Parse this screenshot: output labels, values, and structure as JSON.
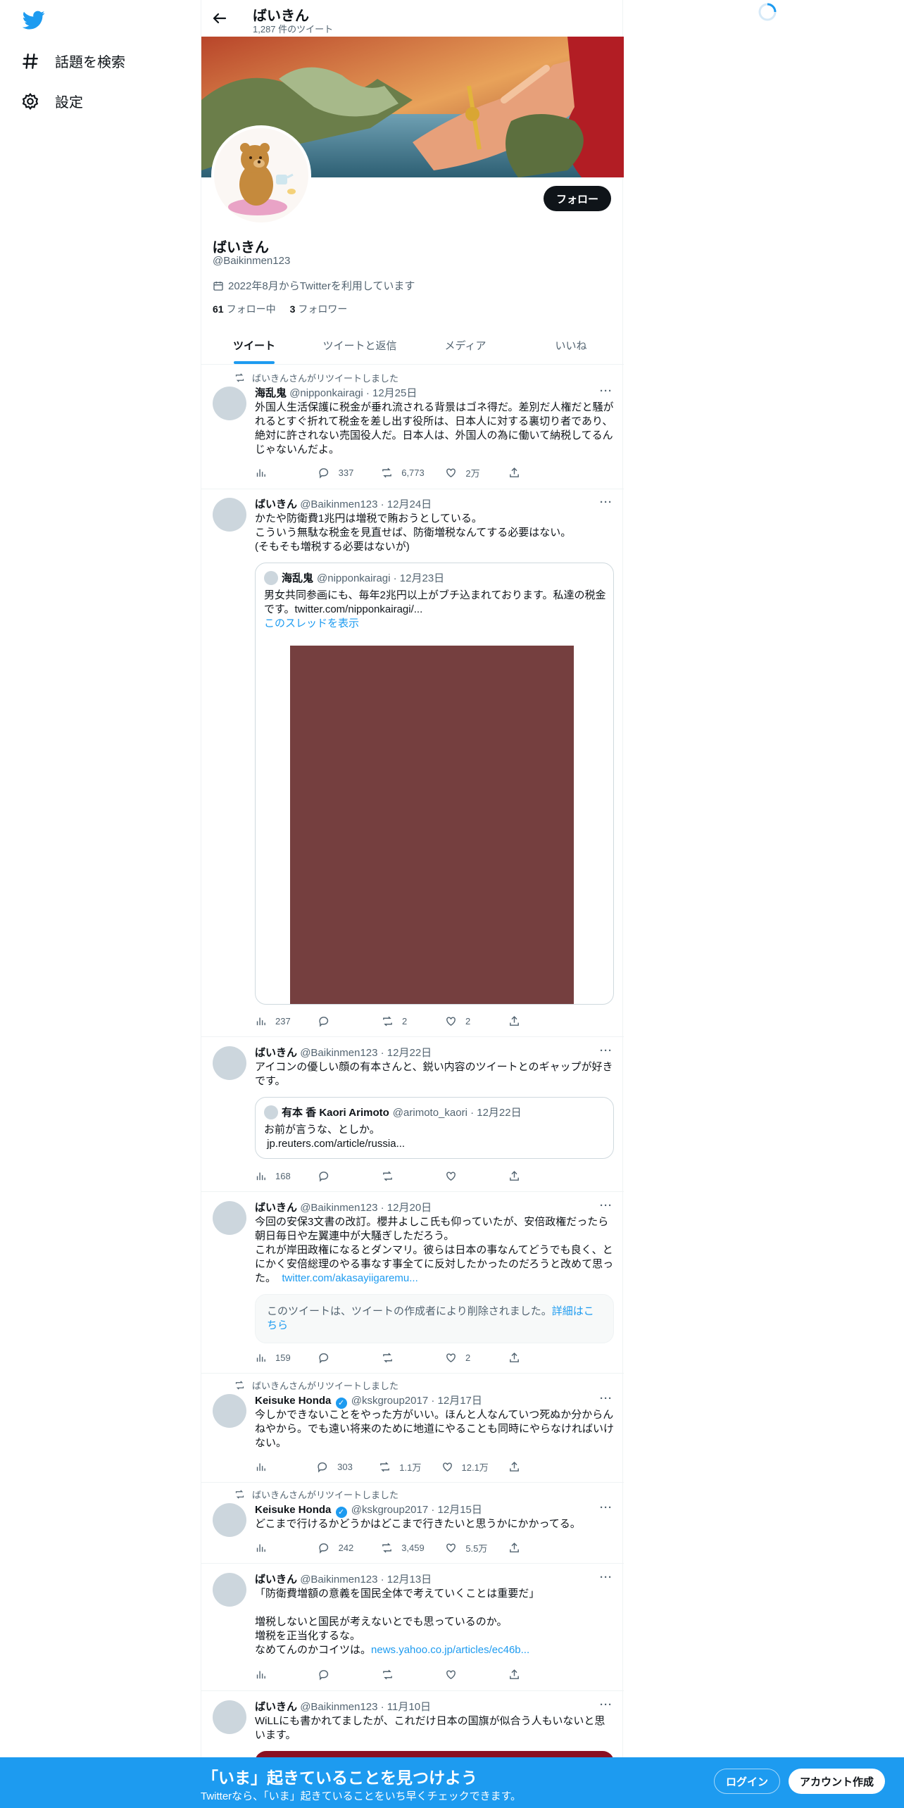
{
  "nav": {
    "explore_label": "話題を検索",
    "settings_label": "設定"
  },
  "header": {
    "title": "ばいきん",
    "subtitle": "1,287 件のツイート"
  },
  "profile": {
    "follow_label": "フォロー",
    "name": "ばいきん",
    "handle": "@Baikinmen123",
    "joined": "2022年8月からTwitterを利用しています",
    "following_count": "61",
    "following_label": "フォロー中",
    "followers_count": "3",
    "followers_label": "フォロワー"
  },
  "tabs": [
    "ツイート",
    "ツイートと返信",
    "メディア",
    "いいね"
  ],
  "tweets": [
    {
      "retweeted_by": "ばいきんさんがリツイートしました",
      "name": "海乱鬼",
      "meta": "@nipponkairagi · 12月25日",
      "text": "外国人生活保護に税金が垂れ流される背景はゴネ得だ。差別だ人権だと騒がれるとすぐ折れて税金を差し出す役所は、日本人に対する裏切り者であり、絶対に許されない売国役人だ。日本人は、外国人の為に働いて納税してるんじゃないんだよ。",
      "views": "",
      "replies": "337",
      "retweets": "6,773",
      "likes": "2万"
    },
    {
      "name": "ばいきん",
      "meta": "@Baikinmen123 · 12月24日",
      "text": "かたや防衛費1兆円は増税で賄おうとしている。\nこういう無駄な税金を見直せば、防衛増税なんてする必要はない。\n(そもそも増税する必要はないが)",
      "quote_name": "海乱鬼",
      "quote_meta": "@nipponkairagi · 12月23日",
      "quote_text": "男女共同参画にも、毎年2兆円以上がブチ込まれております。私達の税金です。twitter.com/nipponkairagi/...",
      "quote_link": "このスレッドを表示",
      "views": "237",
      "replies": "",
      "retweets": "2",
      "likes": "2"
    },
    {
      "name": "ばいきん",
      "meta": "@Baikinmen123 · 12月22日",
      "text": "アイコンの優しい顔の有本さんと、鋭い内容のツイートとのギャップが好きです。",
      "quote_name": "有本 香 Kaori Arimoto",
      "quote_meta": "@arimoto_kaori · 12月22日",
      "quote_text": "お前が言うな、としか。\n jp.reuters.com/article/russia...",
      "views": "168",
      "replies": "",
      "retweets": "",
      "likes": ""
    },
    {
      "name": "ばいきん",
      "meta": "@Baikinmen123 · 12月20日",
      "text": "今回の安保3文書の改訂。櫻井よしこ氏も仰っていたが、安倍政権だったら朝日毎日や左翼連中が大騒ぎしただろう。\nこれが岸田政権になるとダンマリ。彼らは日本の事なんてどうでも良く、とにかく安倍総理のやる事なす事全てに反対したかったのだろうと改めて思った。",
      "text_link": "twitter.com/akasayiigaremu...",
      "deleted_text": "このツイートは、ツイートの作成者により削除されました。",
      "deleted_link": "詳細はこちら",
      "views": "159",
      "replies": "",
      "retweets": "",
      "likes": "2"
    },
    {
      "retweeted_by": "ばいきんさんがリツイートしました",
      "name": "Keisuke Honda",
      "meta": "@kskgroup2017 · 12月17日",
      "text": "今しかできないことをやった方がいい。ほんと人なんていつ死ぬか分からんねやから。でも遠い将来のために地道にやることも同時にやらなければいけない。",
      "views": "",
      "replies": "303",
      "retweets": "1.1万",
      "likes": "12.1万"
    },
    {
      "retweeted_by": "ばいきんさんがリツイートしました",
      "name": "Keisuke Honda",
      "meta": "@kskgroup2017 · 12月15日",
      "text": "どこまで行けるかどうかはどこまで行きたいと思うかにかかってる。",
      "views": "",
      "replies": "242",
      "retweets": "3,459",
      "likes": "5.5万"
    },
    {
      "name": "ばいきん",
      "meta": "@Baikinmen123 · 12月13日",
      "text": "「防衛費増額の意義を国民全体で考えていくことは重要だ」\n\n増税しないと国民が考えないとでも思っているのか。\n増税を正当化するな。\nなめてんのかコイツは。",
      "text_link": "news.yahoo.co.jp/articles/ec46b...",
      "views": "",
      "replies": "",
      "retweets": "",
      "likes": ""
    },
    {
      "name": "ばいきん",
      "meta": "@Baikinmen123 · 11月10日",
      "text": "WiLLにも書かれてましたが、これだけ日本の国旗が似合う人もいないと思います。"
    }
  ],
  "bottom_bar": {
    "title": "「いま」起きていることを見つけよう",
    "subtitle": "Twitterなら、「いま」起きていることをいち早くチェックできます。",
    "login_label": "ログイン",
    "signup_label": "アカウント作成"
  },
  "colors": {
    "accent": "#1d9bf0",
    "text": "#0f1419",
    "muted": "#536471",
    "media_placeholder": "#753f3f"
  }
}
